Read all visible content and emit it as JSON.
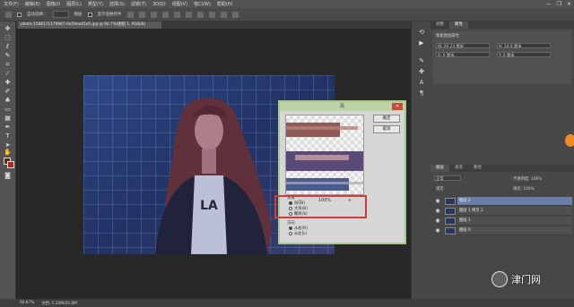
{
  "menubar": {
    "items": [
      "文件(F)",
      "编辑(E)",
      "图像(I)",
      "图层(L)",
      "类型(Y)",
      "选择(S)",
      "滤镜(T)",
      "3D(D)",
      "视图(V)",
      "窗口(W)",
      "帮助(H)"
    ],
    "window_controls": [
      "—",
      "❐",
      "✕"
    ]
  },
  "options": {
    "auto_select_label": "自动选择：",
    "layer_label": "图层",
    "show_transform_label": "显示变换控件"
  },
  "document": {
    "tab_title": "photo-1588171179967-0e59ea41e5.jpg @ 66.7%(图层 1, RGB/8)"
  },
  "dialog": {
    "title": "风",
    "ok_label": "确定",
    "cancel_label": "取消",
    "zoom_level": "100%",
    "zoom_minus": "−",
    "zoom_plus": "+",
    "method_label": "方法",
    "method_options": [
      "风(W)",
      "大风(B)",
      "飓风(S)"
    ],
    "direction_label": "方向",
    "direction_options": [
      "从右(R)",
      "从左(L)"
    ]
  },
  "right_panel": {
    "tabs_top": [
      "调整",
      "属性"
    ],
    "tabs_mid": [
      "颜色",
      "色板"
    ],
    "props_title": "像素图层属性",
    "w_label": "W: 20.23 厘米",
    "h_label": "H: 14.6 厘米",
    "x_label": "X: 0 厘米",
    "y_label": "Y: 0 厘米",
    "mini_items": [
      "颜色",
      "色板"
    ],
    "layers_tabs": [
      "图层",
      "通道",
      "路径"
    ],
    "blend_mode": "正常",
    "opacity_label": "不透明度: 100%",
    "fill_label": "填充: 100%",
    "lock_label": "锁定:",
    "layers": [
      {
        "name": "图层 2",
        "selected": true
      },
      {
        "name": "图层 1 拷贝 2",
        "selected": false
      },
      {
        "name": "图层 1",
        "selected": false
      },
      {
        "name": "图层 0",
        "selected": false
      }
    ]
  },
  "status": {
    "zoom": "66.67%",
    "doc_info": "文档: 5.20M/20.8M"
  },
  "watermark": {
    "text": "津门网"
  },
  "colors": {
    "foreground": "#5a2c1a",
    "background": "#b22222",
    "highlight": "#d43a3a",
    "accent": "#f08a24"
  }
}
